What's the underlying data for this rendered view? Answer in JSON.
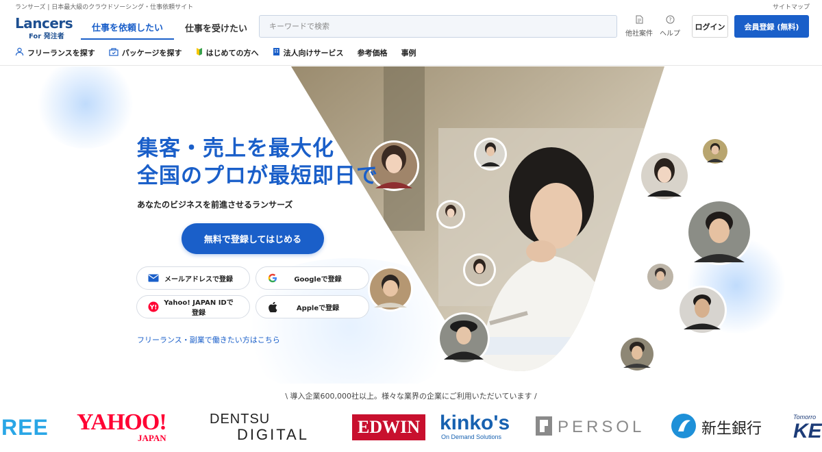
{
  "topbar": {
    "tagline": "ランサーズ | 日本最大級のクラウドソーシング・仕事依頼サイト",
    "sitemap": "サイトマップ"
  },
  "header": {
    "logo_word": "Lancers",
    "logo_sub": "For 発注者",
    "tabs": [
      {
        "label": "仕事を依頼したい",
        "active": true
      },
      {
        "label": "仕事を受けたい",
        "active": false
      }
    ],
    "search_placeholder": "キーワードで検索",
    "other_projects": "他社案件",
    "help": "ヘルプ",
    "login": "ログイン",
    "register": "会員登録 (無料)"
  },
  "subnav": [
    {
      "label": "フリーランスを探す",
      "icon": "person-icon"
    },
    {
      "label": "パッケージを探す",
      "icon": "package-icon"
    },
    {
      "label": "はじめての方へ",
      "icon": "beginner-icon"
    },
    {
      "label": "法人向けサービス",
      "icon": "building-icon"
    },
    {
      "label": "参考価格",
      "icon": ""
    },
    {
      "label": "事例",
      "icon": ""
    }
  ],
  "hero": {
    "headline_1": "集客・売上を最大化",
    "headline_2": "全国のプロが最短即日で",
    "lead": "あなたのビジネスを前進させるランサーズ",
    "cta": "無料で登録してはじめる",
    "sso": {
      "mail": "メールアドレスで登録",
      "google": "Googleで登録",
      "yahoo": "Yahoo! JAPAN IDで登録",
      "apple": "Appleで登録"
    },
    "freelance_link": "フリーランス・副業で働きたい方はこちら"
  },
  "clients": {
    "trust_line": "\\ 導入企業600,000社以上。様々な業界の企業にご利用いただいています /",
    "logos": [
      {
        "text": "REE"
      },
      {
        "text": "YAHOO!",
        "sub": "JAPAN"
      },
      {
        "text": "DENTSU",
        "sub": "DIGITAL"
      },
      {
        "text": "EDWIN"
      },
      {
        "text": "kinko's",
        "sub": "On Demand Solutions"
      },
      {
        "text": "PERSOL"
      },
      {
        "text": "新生銀行"
      },
      {
        "text": "KE",
        "sub": "Tomorro"
      }
    ]
  },
  "colors": {
    "brand": "#1a5fc9",
    "logo": "#1d4f91",
    "yahoo_red": "#ff0033",
    "edwin_red": "#c8102e"
  }
}
